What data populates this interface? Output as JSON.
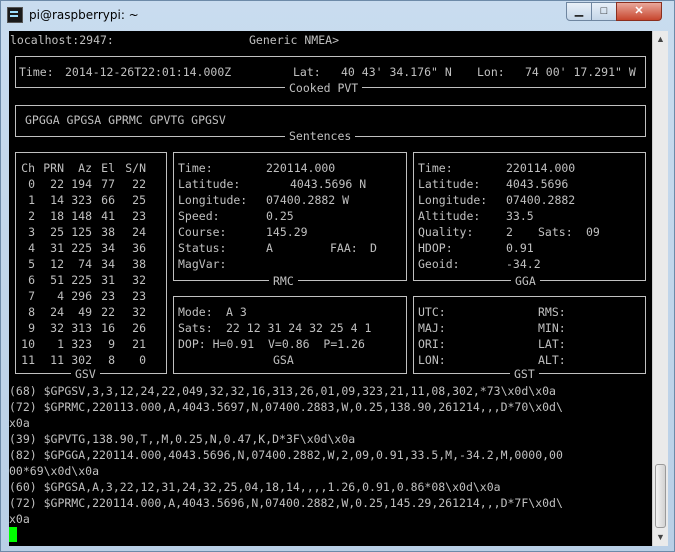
{
  "window": {
    "title": "pi@raspberrypi: ~",
    "min": "▁",
    "max": "□",
    "close": "✕"
  },
  "header": {
    "host": "localhost:2947:",
    "mode": "Generic NMEA>"
  },
  "pvt": {
    "label": "Cooked PVT",
    "time_label": "Time:",
    "time": "2014-12-26T22:01:14.000Z",
    "lat_label": "Lat:",
    "lat": "40 43' 34.176\" N",
    "lon_label": "Lon:",
    "lon": "74 00' 17.291\" W"
  },
  "sentences": {
    "label": "Sentences",
    "list": "GPGGA GPGSA GPRMC GPVTG GPGSV"
  },
  "gsv": {
    "label": "GSV",
    "headers": [
      "Ch",
      "PRN",
      "Az",
      "El",
      "S/N"
    ],
    "rows": [
      [
        "0",
        "22",
        "194",
        "77",
        "22"
      ],
      [
        "1",
        "14",
        "323",
        "66",
        "25"
      ],
      [
        "2",
        "18",
        "148",
        "41",
        "23"
      ],
      [
        "3",
        "25",
        "125",
        "38",
        "24"
      ],
      [
        "4",
        "31",
        "225",
        "34",
        "36"
      ],
      [
        "5",
        "12",
        "74",
        "34",
        "38"
      ],
      [
        "6",
        "51",
        "225",
        "31",
        "32"
      ],
      [
        "7",
        "4",
        "296",
        "23",
        "23"
      ],
      [
        "8",
        "24",
        "49",
        "22",
        "32"
      ],
      [
        "9",
        "32",
        "313",
        "16",
        "26"
      ],
      [
        "10",
        "1",
        "323",
        "9",
        "21"
      ],
      [
        "11",
        "11",
        "302",
        "8",
        "0"
      ]
    ]
  },
  "rmc": {
    "label": "RMC",
    "time_label": "Time:",
    "time": "220114.000",
    "lat_label": "Latitude:",
    "lat": "4043.5696 N",
    "lon_label": "Longitude:",
    "lon": "07400.2882 W",
    "speed_label": "Speed:",
    "speed": "0.25",
    "course_label": "Course:",
    "course": "145.29",
    "status_label": "Status:",
    "status": "A",
    "faa_label": "FAA:",
    "faa": "D",
    "magvar_label": "MagVar:"
  },
  "gga": {
    "label": "GGA",
    "time_label": "Time:",
    "time": "220114.000",
    "lat_label": "Latitude:",
    "lat": "4043.5696",
    "lon_label": "Longitude:",
    "lon": "07400.2882",
    "alt_label": "Altitude:",
    "alt": "33.5",
    "quality_label": "Quality:",
    "quality": "2",
    "sats_label": "Sats:",
    "sats": "09",
    "hdop_label": "HDOP:",
    "hdop": "0.91",
    "geoid_label": "Geoid:",
    "geoid": "-34.2"
  },
  "gsa": {
    "label": "GSA",
    "mode_label": "Mode:",
    "mode": "A 3",
    "sats_label": "Sats:",
    "sats": "22 12 31 24 32 25 4 1",
    "dop_line": "DOP: H=0.91  V=0.86  P=1.26"
  },
  "gst": {
    "label": "GST",
    "utc": "UTC:",
    "rms": "RMS:",
    "maj": "MAJ:",
    "min": "MIN:",
    "ori": "ORI:",
    "lat": "LAT:",
    "lon": "LON:",
    "alt": "ALT:"
  },
  "log": [
    "(68) $GPGSV,3,3,12,24,22,049,32,32,16,313,26,01,09,323,21,11,08,302,*73\\x0d\\x0a",
    "(72) $GPRMC,220113.000,A,4043.5697,N,07400.2883,W,0.25,138.90,261214,,,D*70\\x0d\\",
    "x0a",
    "(39) $GPVTG,138.90,T,,M,0.25,N,0.47,K,D*3F\\x0d\\x0a",
    "(82) $GPGGA,220114.000,4043.5696,N,07400.2882,W,2,09,0.91,33.5,M,-34.2,M,0000,00",
    "00*69\\x0d\\x0a",
    "(60) $GPGSA,A,3,22,12,31,24,32,25,04,18,14,,,,1.26,0.91,0.86*08\\x0d\\x0a",
    "(72) $GPRMC,220114.000,A,4043.5696,N,07400.2882,W,0.25,145.29,261214,,,D*7F\\x0d\\",
    "x0a"
  ],
  "colors": {
    "terminal_bg": "#000000",
    "terminal_fg": "#c0c0c0",
    "cursor": "#00ff00"
  }
}
